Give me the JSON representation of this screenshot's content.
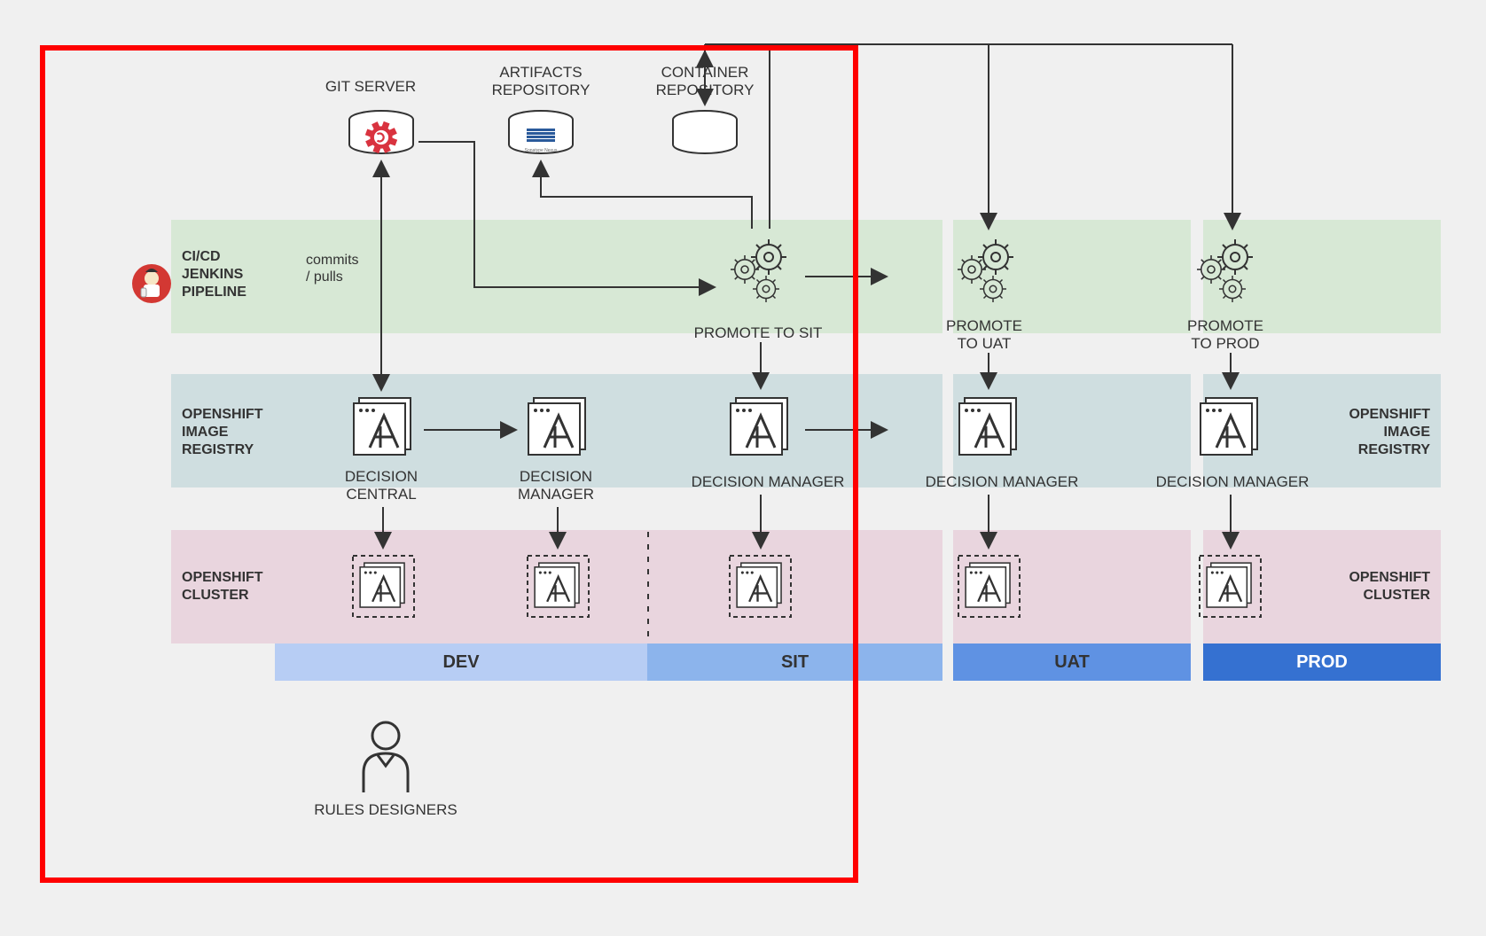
{
  "top": {
    "git": "GIT SERVER",
    "artifacts1": "ARTIFACTS",
    "artifacts2": "REPOSITORY",
    "container1": "CONTAINER",
    "container2": "REPOSITORY"
  },
  "bands": {
    "cicd": "CI/CD\nJENKINS\nPIPELINE",
    "openshift_image": "OPENSHIFT\nIMAGE\nREGISTRY",
    "openshift_cluster": "OPENSHIFT\nCLUSTER"
  },
  "promote": {
    "sit": "PROMOTE TO SIT",
    "uat": "PROMOTE\nTO UAT",
    "prod": "PROMOTE\nTO PROD"
  },
  "nodes": {
    "decision_central": "DECISION\nCENTRAL",
    "decision_manager": "DECISION\nMANAGER",
    "decision_manager_single": "DECISION MANAGER"
  },
  "env": {
    "dev": "DEV",
    "sit": "SIT",
    "uat": "UAT",
    "prod": "PROD"
  },
  "bottom": "RULES DESIGNERS",
  "arrow": "commits\n/ pulls"
}
